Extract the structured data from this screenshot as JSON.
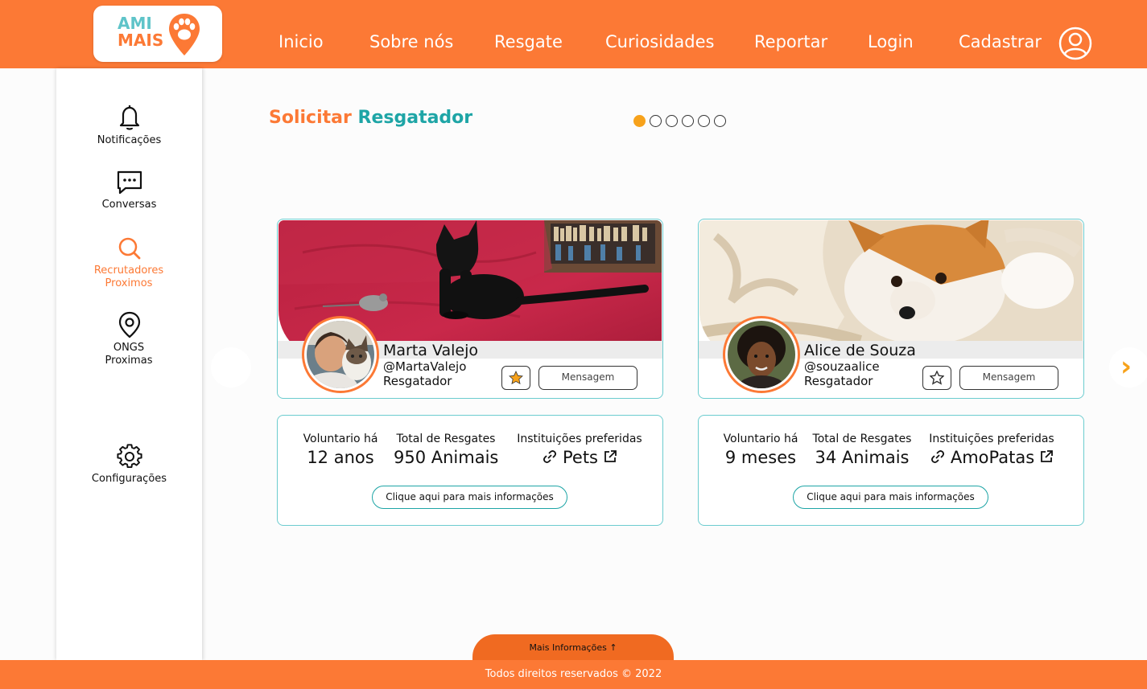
{
  "header": {
    "logo_line1": "AMI",
    "logo_line2": "MAIS",
    "nav": [
      "Inicio",
      "Sobre nós",
      "Resgate",
      "Curiosidades",
      "Reportar",
      "Login",
      "Cadastrar"
    ]
  },
  "sidebar": {
    "items": [
      {
        "label": "Notificações",
        "icon": "bell-icon"
      },
      {
        "label": "Conversas",
        "icon": "chat-icon"
      },
      {
        "label": "Recrutadores Proximos",
        "icon": "search-icon",
        "active": true
      },
      {
        "label": "ONGS Proximas",
        "icon": "location-pin-icon"
      },
      {
        "label": "Configurações",
        "icon": "gear-icon"
      }
    ]
  },
  "main": {
    "title_part1": "Solicitar",
    "title_part2": "Resgatador",
    "carousel_pages": 6,
    "carousel_active": 1
  },
  "cards": [
    {
      "name": "Marta Valejo",
      "handle": "@MartaValejo",
      "role": "Resgatador",
      "favorited": true,
      "message_label": "Mensagem",
      "stats": {
        "volunteer_label": "Voluntario há",
        "volunteer_value": "12 anos",
        "rescues_label": "Total de Resgates",
        "rescues_value": "950 Animais",
        "institutions_label": "Instituições preferidas",
        "institutions_value": "Pets"
      },
      "more_label": "Clique aqui para mais informações"
    },
    {
      "name": "Alice de Souza",
      "handle": "@souzaalice",
      "role": "Resgatador",
      "favorited": false,
      "message_label": "Mensagem",
      "stats": {
        "volunteer_label": "Voluntario há",
        "volunteer_value": "9 meses",
        "rescues_label": "Total de Resgates",
        "rescues_value": "34 Animais",
        "institutions_label": "Instituições preferidas",
        "institutions_value": "AmoPatas"
      },
      "more_label": "Clique aqui para mais informações"
    }
  ],
  "footer": {
    "more_info_label": "Mais Informações ↑",
    "copyright": "Todos direitos reservados © 2022"
  },
  "colors": {
    "brand_orange": "#fc7935",
    "brand_teal": "#1ea5a6",
    "accent_yellow": "#f7a21b"
  }
}
